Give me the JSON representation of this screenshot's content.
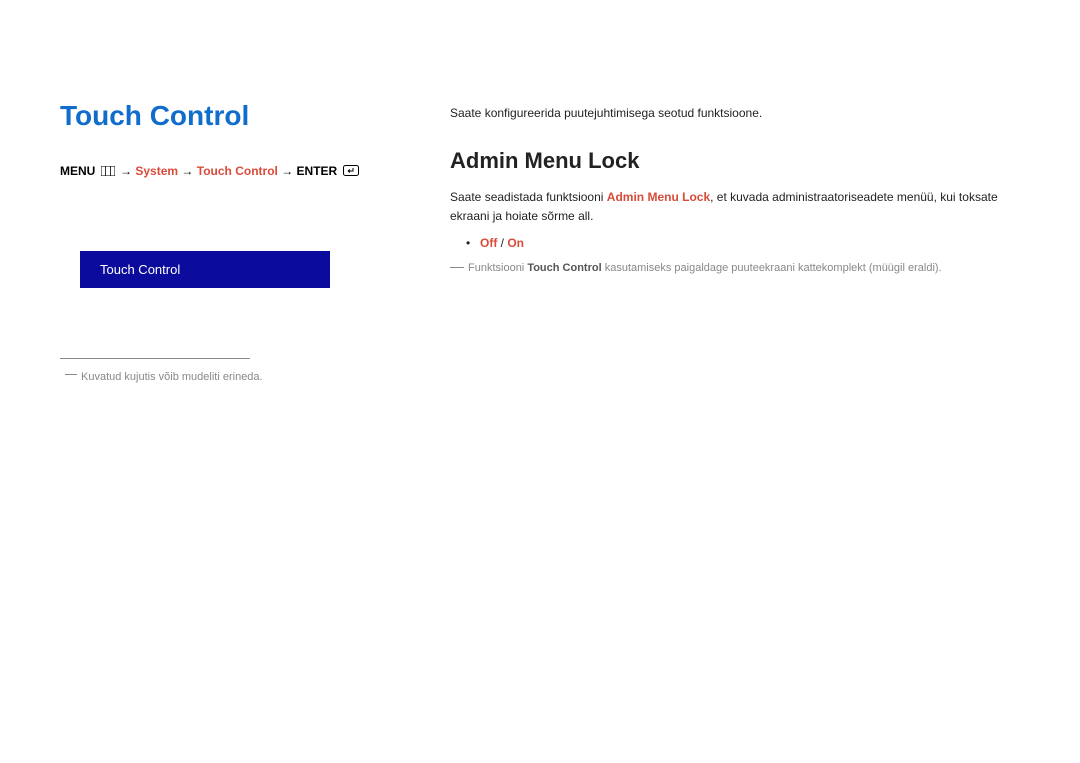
{
  "left": {
    "title": "Touch Control",
    "breadcrumb": {
      "menu_label": "MENU",
      "arrow": " → ",
      "system": "System",
      "touch_control": "Touch Control",
      "enter_label": "ENTER"
    },
    "menu_item": "Touch Control",
    "footnote": "Kuvatud kujutis võib mudeliti erineda."
  },
  "right": {
    "intro": "Saate konfigureerida puutejuhtimisega seotud funktsioone.",
    "heading": "Admin Menu Lock",
    "para_pre": "Saate seadistada funktsiooni ",
    "para_hl": "Admin Menu Lock",
    "para_post": ", et kuvada administraatoriseadete menüü, kui toksate ekraani ja hoiate sõrme all.",
    "opt_off": "Off",
    "opt_sep": " / ",
    "opt_on": "On",
    "note_pre": "Funktsiooni ",
    "note_hl": "Touch Control",
    "note_post": " kasutamiseks paigaldage puuteekraani kattekomplekt (müügil eraldi)."
  }
}
